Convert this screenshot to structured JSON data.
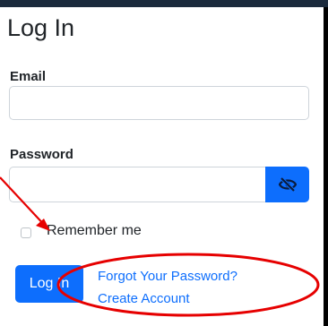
{
  "form": {
    "title": "Log In",
    "email_label": "Email",
    "email_value": "",
    "password_label": "Password",
    "password_value": "",
    "remember_label": "Remember me",
    "remember_checked": false,
    "login_button": "Log In",
    "forgot_link": "Forgot Your Password?",
    "create_link": "Create Account"
  },
  "icons": {
    "password_toggle": "eye-slash-icon"
  },
  "colors": {
    "primary": "#0d6efd",
    "annotation": "#e60000"
  }
}
